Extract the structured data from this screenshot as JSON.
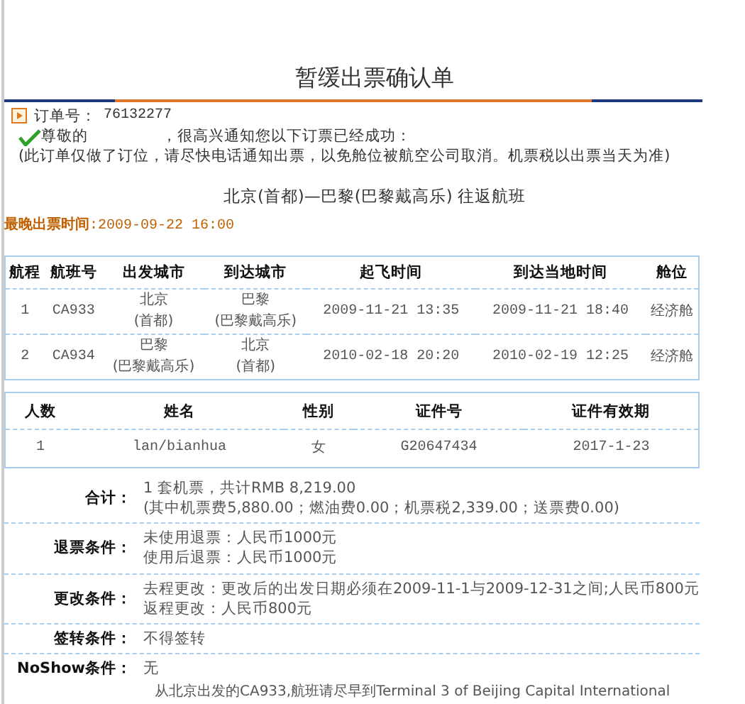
{
  "title": "暂缓出票确认单",
  "order": {
    "label": "订单号：",
    "number": "76132277"
  },
  "greeting": {
    "salutation": "尊敬的",
    "message": "，很高兴通知您以下订票已经成功："
  },
  "note": "(此订单仅做了订位，请尽快电话通知出票，以免舱位被航空公司取消。机票税以出票当天为准)",
  "route_title": "北京(首都)—巴黎(巴黎戴高乐) 往返航班",
  "deadline": {
    "label": "最晚出票时间",
    "value": ":2009-09-22 16:00"
  },
  "flights": {
    "columns": [
      "航程",
      "航班号",
      "出发城市",
      "到达城市",
      "起飞时间",
      "到达当地时间",
      "舱位"
    ],
    "rows": [
      {
        "cells": [
          [
            "1"
          ],
          [
            "CA933"
          ],
          [
            "北京",
            "(首都)"
          ],
          [
            "巴黎",
            "(巴黎戴高乐)"
          ],
          [
            "2009-11-21 13:35"
          ],
          [
            "2009-11-21 18:40"
          ],
          [
            "经济舱"
          ]
        ]
      },
      {
        "cells": [
          [
            "2"
          ],
          [
            "CA934"
          ],
          [
            "巴黎",
            "(巴黎戴高乐)"
          ],
          [
            "北京",
            "(首都)"
          ],
          [
            "2010-02-18 20:20"
          ],
          [
            "2010-02-19 12:25"
          ],
          [
            "经济舱"
          ]
        ]
      }
    ]
  },
  "passengers": {
    "columns": [
      "人数",
      "姓名",
      "性别",
      "证件号",
      "证件有效期"
    ],
    "rows": [
      {
        "cells": [
          "1",
          "lan/bianhua",
          "女",
          "G20647434",
          "2017-1-23"
        ]
      }
    ]
  },
  "terms": [
    {
      "label": "合计：",
      "lines": [
        "1 套机票，共计RMB 8,219.00",
        "(其中机票费5,880.00；燃油费0.00；机票税2,339.00；送票费0.00)"
      ]
    },
    {
      "label": "退票条件：",
      "lines": [
        "未使用退票：人民币1000元",
        "使用后退票：人民币1000元"
      ]
    },
    {
      "label": "更改条件：",
      "lines": [
        "去程更改：更改后的出发日期必须在2009-11-1与2009-12-31之间;人民币800元",
        "返程更改：人民币800元"
      ]
    },
    {
      "label": "签转条件：",
      "lines": [
        "不得签转"
      ]
    },
    {
      "label": "NoShow条件：",
      "lines": [
        "无"
      ]
    }
  ],
  "footer_note": "从北京出发的CA933,航班请尽早到Terminal 3 of Beijing Capital International"
}
